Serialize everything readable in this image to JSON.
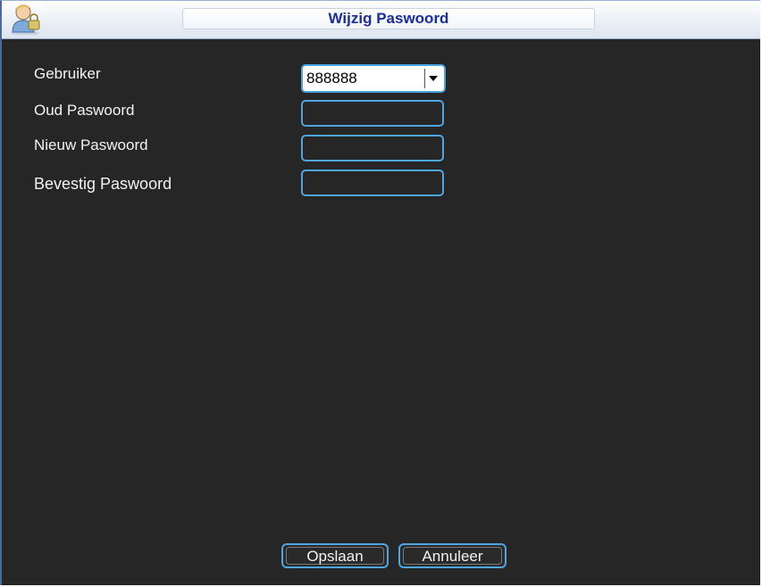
{
  "window": {
    "title": "Wijzig Paswoord",
    "icon": "user-lock-icon"
  },
  "form": {
    "user_label": "Gebruiker",
    "user_value": "888888",
    "old_password_label": "Oud Paswoord",
    "old_password_value": "",
    "new_password_label": "Nieuw Paswoord",
    "new_password_value": "",
    "confirm_password_label": "Bevestig Paswoord",
    "confirm_password_value": ""
  },
  "buttons": {
    "save_label": "Opslaan",
    "cancel_label": "Annuleer"
  },
  "colors": {
    "background": "#262626",
    "field_border": "#4da6e0",
    "title_text": "#1a2ea0"
  }
}
